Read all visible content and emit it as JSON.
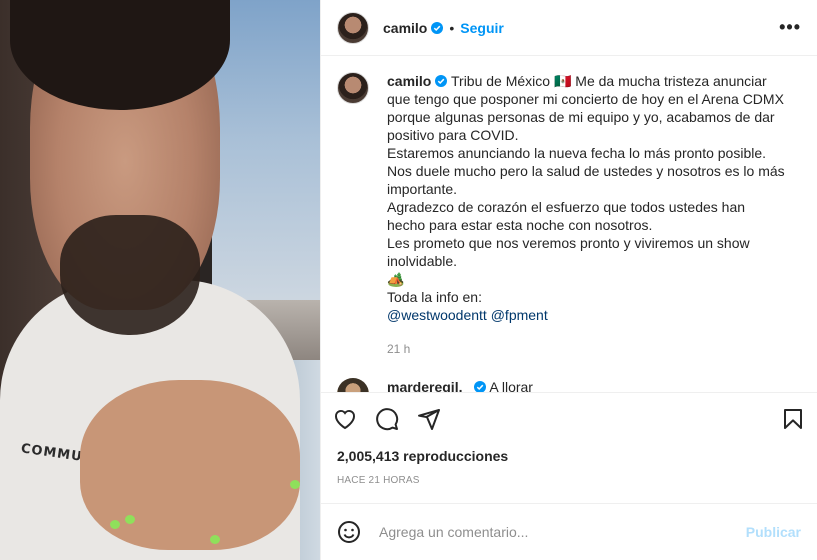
{
  "media": {
    "shirt_print": "COMMUNITY  X  LA  TRIBU"
  },
  "post": {
    "author": "camilo",
    "separator": "•",
    "follow_label": "Seguir",
    "more_label": "•••"
  },
  "caption": {
    "username": "camilo",
    "lines": [
      "Tribu de México 🇲🇽 Me da mucha tristeza anunciar que tengo que posponer mi concierto de hoy en el Arena CDMX porque algunas personas de mi equipo y yo, acabamos de dar positivo para COVID.",
      "Estaremos anunciando la nueva fecha lo más pronto posible.",
      "Nos duele mucho pero la salud de ustedes y nosotros es lo más importante.",
      "Agradezco de corazón el esfuerzo que todos ustedes han hecho para estar esta noche con nosotros.",
      "Les prometo que nos veremos pronto y viviremos un show inolvidable.",
      "🏕️",
      "Toda la info en:"
    ],
    "mentions": [
      "@westwoodentt",
      "@fpment"
    ],
    "time": "21 h"
  },
  "comments": [
    {
      "username": "marderegil._",
      "text": "A llorar"
    }
  ],
  "views": "2,005,413 reproducciones",
  "posted_ago": "HACE 21 HORAS",
  "composer": {
    "placeholder": "Agrega un comentario...",
    "publish_label": "Publicar"
  },
  "colors": {
    "accent": "#0095f6",
    "publish_disabled": "#b2dffc",
    "mention": "#00376b",
    "muted": "#8e8e8e"
  },
  "icons": [
    "verified-badge-icon",
    "more-options-icon",
    "heart-icon",
    "comment-icon",
    "share-icon",
    "save-icon",
    "emoji-icon"
  ]
}
